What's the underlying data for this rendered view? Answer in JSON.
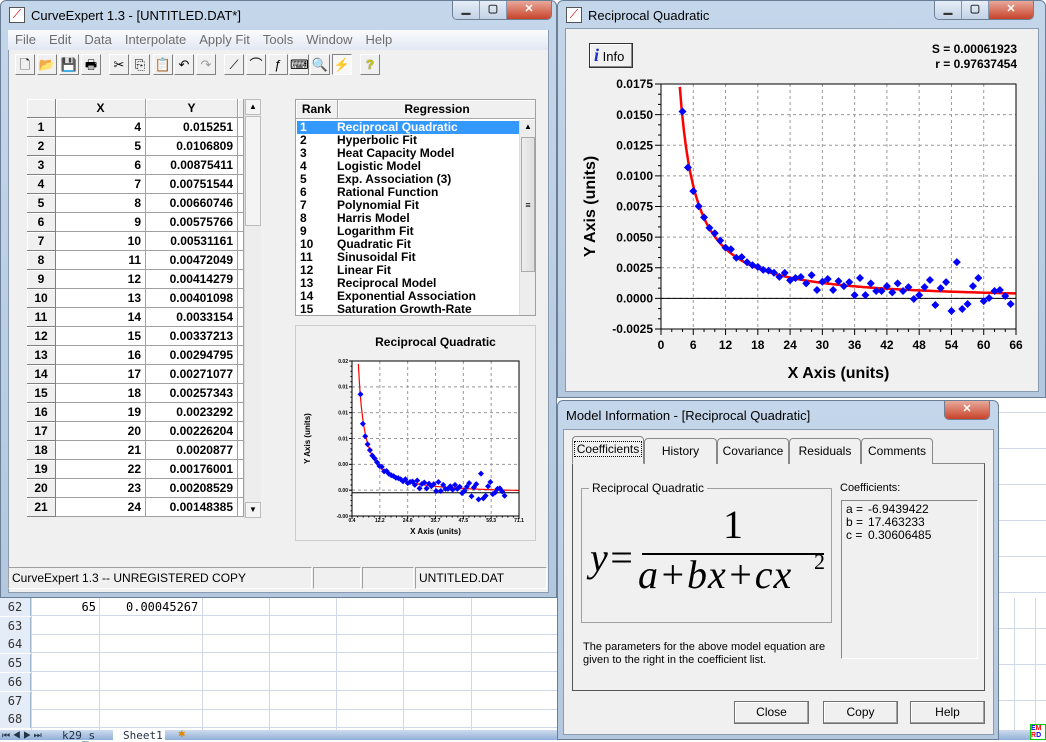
{
  "spreadsheet": {
    "rows": [
      {
        "num": "62",
        "x": "65",
        "y": "0.00045267"
      },
      {
        "num": "63",
        "x": "",
        "y": ""
      },
      {
        "num": "64",
        "x": "",
        "y": ""
      },
      {
        "num": "65",
        "x": "",
        "y": ""
      },
      {
        "num": "66",
        "x": "",
        "y": ""
      },
      {
        "num": "67",
        "x": "",
        "y": ""
      },
      {
        "num": "68",
        "x": "",
        "y": ""
      }
    ],
    "sheet_tabs": [
      "k29_s",
      "Sheet1"
    ]
  },
  "main_window": {
    "title": "CurveExpert 1.3 - [UNTITLED.DAT*]",
    "menu": [
      "File",
      "Edit",
      "Data",
      "Interpolate",
      "Apply Fit",
      "Tools",
      "Window",
      "Help"
    ],
    "toolbar": [
      {
        "icon": "new-file-icon",
        "glyph": "🗋"
      },
      {
        "icon": "open-folder-icon",
        "glyph": "📂"
      },
      {
        "icon": "save-icon",
        "glyph": "💾"
      },
      {
        "icon": "print-icon",
        "glyph": "🖶"
      },
      {
        "icon": "cut-icon",
        "glyph": "✂"
      },
      {
        "icon": "copy-icon",
        "glyph": "⎘"
      },
      {
        "icon": "paste-icon",
        "glyph": "📋",
        "disabled": true
      },
      {
        "icon": "undo-icon",
        "glyph": "↶"
      },
      {
        "icon": "redo-icon",
        "glyph": "↷",
        "disabled": true
      },
      {
        "icon": "linear-plot-icon",
        "glyph": "⟋"
      },
      {
        "icon": "curve-plot-icon",
        "glyph": "⌒"
      },
      {
        "icon": "function-plot-icon",
        "glyph": "ƒ"
      },
      {
        "icon": "keyboard-icon",
        "glyph": "⌨"
      },
      {
        "icon": "magnify-icon",
        "glyph": "🔍"
      },
      {
        "icon": "lightning-icon",
        "glyph": "⚡",
        "pressed": true
      },
      {
        "icon": "help-icon",
        "glyph": "?"
      }
    ],
    "table": {
      "headers": [
        "X",
        "Y"
      ],
      "rows": [
        {
          "n": "1",
          "x": "4",
          "y": "0.015251"
        },
        {
          "n": "2",
          "x": "5",
          "y": "0.0106809"
        },
        {
          "n": "3",
          "x": "6",
          "y": "0.00875411"
        },
        {
          "n": "4",
          "x": "7",
          "y": "0.00751544"
        },
        {
          "n": "5",
          "x": "8",
          "y": "0.00660746"
        },
        {
          "n": "6",
          "x": "9",
          "y": "0.00575766"
        },
        {
          "n": "7",
          "x": "10",
          "y": "0.00531161"
        },
        {
          "n": "8",
          "x": "11",
          "y": "0.00472049"
        },
        {
          "n": "9",
          "x": "12",
          "y": "0.00414279"
        },
        {
          "n": "10",
          "x": "13",
          "y": "0.00401098"
        },
        {
          "n": "11",
          "x": "14",
          "y": "0.0033154"
        },
        {
          "n": "12",
          "x": "15",
          "y": "0.00337213"
        },
        {
          "n": "13",
          "x": "16",
          "y": "0.00294795"
        },
        {
          "n": "14",
          "x": "17",
          "y": "0.00271077"
        },
        {
          "n": "15",
          "x": "18",
          "y": "0.00257343"
        },
        {
          "n": "16",
          "x": "19",
          "y": "0.0023292"
        },
        {
          "n": "17",
          "x": "20",
          "y": "0.00226204"
        },
        {
          "n": "18",
          "x": "21",
          "y": "0.0020877"
        },
        {
          "n": "19",
          "x": "22",
          "y": "0.00176001"
        },
        {
          "n": "20",
          "x": "23",
          "y": "0.00208529"
        },
        {
          "n": "21",
          "x": "24",
          "y": "0.00148385"
        }
      ]
    },
    "rank_list": {
      "headers": [
        "Rank",
        "Regression"
      ],
      "selected": 0,
      "items": [
        {
          "rank": "1",
          "name": "Reciprocal Quadratic"
        },
        {
          "rank": "2",
          "name": "Hyperbolic Fit"
        },
        {
          "rank": "3",
          "name": "Heat Capacity Model"
        },
        {
          "rank": "4",
          "name": "Logistic Model"
        },
        {
          "rank": "5",
          "name": "Exp. Association (3)"
        },
        {
          "rank": "6",
          "name": "Rational Function"
        },
        {
          "rank": "7",
          "name": "Polynomial Fit"
        },
        {
          "rank": "8",
          "name": "Harris Model"
        },
        {
          "rank": "9",
          "name": "Logarithm Fit"
        },
        {
          "rank": "10",
          "name": "Quadratic Fit"
        },
        {
          "rank": "11",
          "name": "Sinusoidal Fit"
        },
        {
          "rank": "12",
          "name": "Linear Fit"
        },
        {
          "rank": "13",
          "name": "Reciprocal Model"
        },
        {
          "rank": "14",
          "name": "Exponential Association"
        },
        {
          "rank": "15",
          "name": "Saturation Growth-Rate"
        }
      ]
    },
    "preview": {
      "title": "Reciprocal Quadratic",
      "xlabel": "X Axis (units)",
      "ylabel": "Y Axis (units)",
      "xticks": [
        "0.4",
        "12.2",
        "24.0",
        "35.7",
        "47.5",
        "59.3",
        "71.1"
      ],
      "yticks": [
        "-0.00",
        "0.00",
        "0.00",
        "0.01",
        "0.01",
        "0.01",
        "0.02"
      ]
    },
    "status": [
      "CurveExpert 1.3 -- UNREGISTERED COPY",
      "",
      "",
      "UNTITLED.DAT"
    ]
  },
  "chart_window": {
    "title": "Reciprocal Quadratic",
    "info_label": "Info",
    "s_text": "S = 0.00061923",
    "r_text": "r = 0.97637454"
  },
  "chart_data": {
    "type": "scatter",
    "xlabel": "X Axis (units)",
    "ylabel": "Y Axis (units)",
    "xlim": [
      0,
      66
    ],
    "ylim": [
      -0.0025,
      0.0175
    ],
    "xticks": [
      "0",
      "6",
      "12",
      "18",
      "24",
      "30",
      "36",
      "42",
      "48",
      "54",
      "60",
      "66"
    ],
    "yticks": [
      "-0.0025",
      "0.0000",
      "0.0025",
      "0.0050",
      "0.0075",
      "0.0100",
      "0.0125",
      "0.0150",
      "0.0175"
    ],
    "grid": true,
    "point_color": "#0000ff",
    "fit_color": "#ff0000",
    "fit_model": "reciprocal quadratic",
    "fit_coefficients": {
      "a": -6.9439422,
      "b": 17.463233,
      "c": 0.30606485
    },
    "x": [
      4,
      5,
      6,
      7,
      8,
      9,
      10,
      11,
      12,
      13,
      14,
      15,
      16,
      17,
      18,
      19,
      20,
      21,
      22,
      23,
      24,
      25,
      26,
      27,
      28,
      29,
      30,
      31,
      32,
      33,
      34,
      35,
      36,
      37,
      38,
      39,
      40,
      41,
      42,
      43,
      44,
      45,
      46,
      47,
      48,
      49,
      50,
      51,
      52,
      53,
      54,
      55,
      56,
      57,
      58,
      59,
      60,
      61,
      62,
      63,
      64,
      65
    ],
    "y": [
      0.015251,
      0.0106809,
      0.00875411,
      0.00751544,
      0.00660746,
      0.00575766,
      0.00531161,
      0.00472049,
      0.00414279,
      0.00401098,
      0.0033154,
      0.00337213,
      0.00294795,
      0.00271077,
      0.00257343,
      0.0023292,
      0.00226204,
      0.0020877,
      0.00176001,
      0.00208529,
      0.00148385,
      0.00166,
      0.00174,
      0.00122,
      0.0019,
      0.00068,
      0.00136,
      0.00158,
      0.00068,
      0.00141,
      0.001,
      0.00133,
      0.00027,
      0.00166,
      0.00027,
      0.00122,
      0.0006,
      0.0006,
      0.001,
      0.00049,
      0.00122,
      0.0006,
      0.00092,
      -5e-05,
      0.00027,
      0.00092,
      0.0015,
      -0.00054,
      0.00084,
      0.00133,
      -0.00103,
      0.00296,
      -0.00087,
      -0.00046,
      0.001,
      0.00166,
      -0.00022,
      3e-05,
      0.0006,
      0.00068,
      0.00019,
      -0.00046
    ]
  },
  "model_window": {
    "title": "Model Information - [Reciprocal Quadratic]",
    "tabs": [
      "Coefficients",
      "History",
      "Covariance",
      "Residuals",
      "Comments"
    ],
    "active_tab": 0,
    "group_title": "Reciprocal Quadratic",
    "formula": {
      "lhs": "y=",
      "numerator": "1",
      "denominator": "a+bx+cx",
      "exponent": "2"
    },
    "description": "The parameters for the above model equation are given to the right in the coefficient list.",
    "coef_label": "Coefficients:",
    "coefficients": [
      {
        "name": "a =",
        "value": "-6.9439422"
      },
      {
        "name": "b =",
        "value": "17.463233"
      },
      {
        "name": "c =",
        "value": "0.30606485"
      }
    ],
    "buttons": [
      "Close",
      "Copy",
      "Help"
    ]
  }
}
